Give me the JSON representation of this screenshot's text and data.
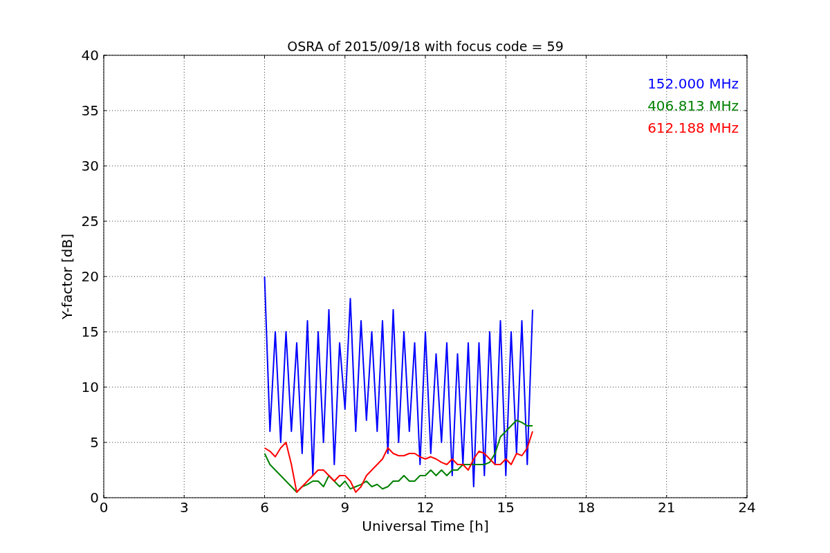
{
  "chart_data": {
    "type": "line",
    "title": "OSRA of 2015/09/18 with focus code = 59",
    "xlabel": "Universal Time [h]",
    "ylabel": "Y-factor [dB]",
    "x": [
      6.0,
      6.2,
      6.4,
      6.6,
      6.8,
      7.0,
      7.2,
      7.4,
      7.6,
      7.8,
      8.0,
      8.2,
      8.4,
      8.6,
      8.8,
      9.0,
      9.2,
      9.4,
      9.6,
      9.8,
      10.0,
      10.2,
      10.4,
      10.6,
      10.8,
      11.0,
      11.2,
      11.4,
      11.6,
      11.8,
      12.0,
      12.2,
      12.4,
      12.6,
      12.8,
      13.0,
      13.2,
      13.4,
      13.6,
      13.8,
      14.0,
      14.2,
      14.4,
      14.6,
      14.8,
      15.0,
      15.2,
      15.4,
      15.6,
      15.8,
      16.0
    ],
    "series": [
      {
        "name": "152.000 MHz",
        "color": "#0000ff",
        "values": [
          20,
          6,
          15,
          5,
          15,
          6,
          14,
          4,
          16,
          2,
          15,
          5,
          17,
          3,
          14,
          8,
          18,
          6,
          16,
          7,
          15,
          6,
          16,
          4,
          17,
          5,
          15,
          6,
          14,
          3,
          15,
          4,
          13,
          5,
          14,
          2,
          13,
          3,
          14,
          1,
          14,
          2,
          15,
          3,
          16,
          2,
          15,
          4,
          16,
          3,
          17
        ]
      },
      {
        "name": "406.813 MHz",
        "color": "#008000",
        "values": [
          4,
          3,
          2.5,
          2,
          1.5,
          1,
          0.5,
          1,
          1.2,
          1.5,
          1.5,
          1,
          2,
          1.5,
          1,
          1.5,
          0.8,
          1,
          1.2,
          1.5,
          1,
          1.2,
          0.8,
          1,
          1.5,
          1.5,
          2,
          1.5,
          1.5,
          2,
          2,
          2.5,
          2,
          2.5,
          2,
          2.5,
          2.5,
          3,
          3,
          3,
          3,
          3,
          3.2,
          4,
          5.5,
          6,
          6.5,
          7,
          6.8,
          6.5,
          6.5
        ]
      },
      {
        "name": "612.188 MHz",
        "color": "#ff0000",
        "values": [
          4.5,
          4.2,
          3.7,
          4.5,
          5,
          3,
          0.5,
          1,
          1.5,
          2,
          2.5,
          2.5,
          2,
          1.5,
          2,
          2,
          1.5,
          0.5,
          1,
          2,
          2.5,
          3,
          3.5,
          4.5,
          4,
          3.8,
          3.8,
          4,
          4,
          3.7,
          3.5,
          3.7,
          3.5,
          3.2,
          3,
          3.5,
          3,
          3,
          2.5,
          3.5,
          4.2,
          4,
          3.5,
          3,
          3,
          3.5,
          3,
          4,
          3.8,
          4.5,
          6
        ]
      }
    ],
    "grid": true,
    "xlim": [
      0,
      24
    ],
    "ylim": [
      0,
      40
    ],
    "xticks": [
      0,
      3,
      6,
      9,
      12,
      15,
      18,
      21,
      24
    ],
    "yticks": [
      0,
      5,
      10,
      15,
      20,
      25,
      30,
      35,
      40
    ]
  }
}
